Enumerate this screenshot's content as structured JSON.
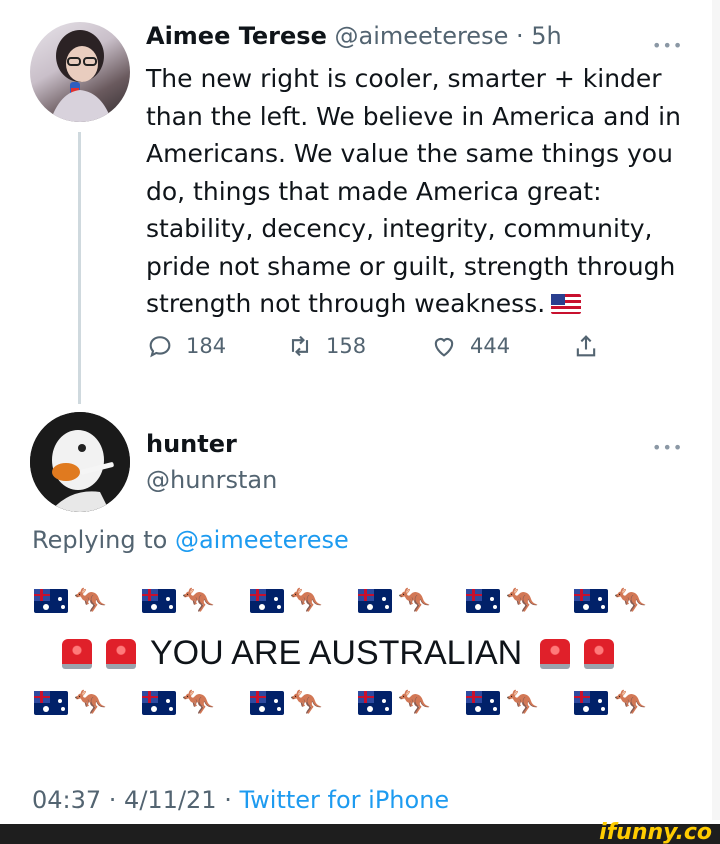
{
  "tweet1": {
    "name": "Aimee Terese",
    "handle": "@aimeeterese",
    "time": "· 5h",
    "text": "The new right is cooler, smarter + kinder than the left. We believe in America and in Americans. We value the same things you do, things that made America great: stability, decency, integrity, community, pride not shame or guilt, strength through strength not through weakness.",
    "actions": {
      "replies": "184",
      "retweets": "158",
      "likes": "444"
    }
  },
  "tweet2": {
    "name": "hunter",
    "handle": "@hunrstan",
    "replying_prefix": "Replying to",
    "replying_mention": "@aimeeterese",
    "main_text": "YOU ARE AUSTRALIAN",
    "timestamp": "04:37 · 4/11/21 ·",
    "source": "Twitter for iPhone"
  },
  "watermark": "ifunny.co",
  "colors": {
    "link": "#1d9bf0",
    "secondary": "#536471",
    "text": "#0f1419"
  },
  "icons": [
    "more-icon",
    "reply-icon",
    "retweet-icon",
    "like-icon",
    "share-icon",
    "flag-us-icon",
    "flag-au-icon",
    "kangaroo-icon",
    "siren-icon"
  ]
}
